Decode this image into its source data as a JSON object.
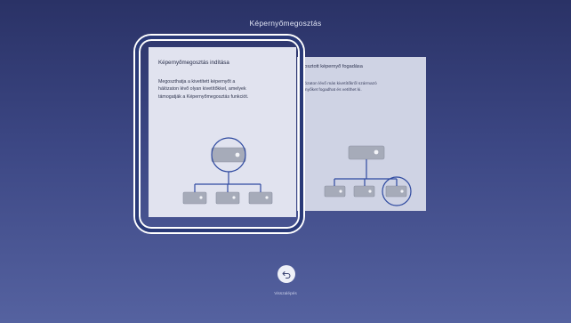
{
  "screen": {
    "title": "Képernyőmegosztás"
  },
  "cards": [
    {
      "title": "Képernyőmegosztás indítása",
      "description_lines": [
        "Megoszthatja a kivetített képernyőt a",
        "hálózaton lévő olyan kivetítőkkel, amelyek",
        "támogatják a Képernyőmegosztás funkciót."
      ],
      "selected": true
    },
    {
      "title": "egosztott képernyő fogadása",
      "description_lines": [
        "hálózaton lévő más kivetítőkről származó",
        "pernyőket fogadhat és vetíthet ki."
      ],
      "selected": false
    }
  ],
  "back_button": {
    "label": "Visszalépés",
    "icon": "return-arrow-icon"
  },
  "colors": {
    "background_top": "#2a3266",
    "background_bottom": "#5562a0",
    "highlight": "#2f4aa0",
    "card_front": "#e1e3ef",
    "card_back": "#cfd3e4"
  }
}
